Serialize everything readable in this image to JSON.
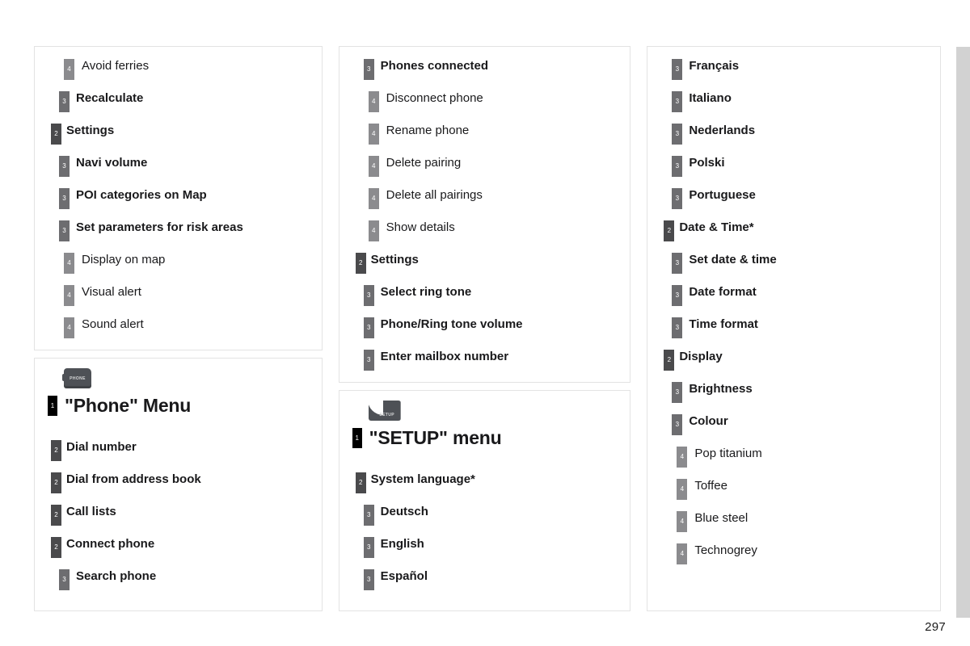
{
  "page": {
    "number": "297",
    "colors": {
      "level1_badge": "#000000",
      "level2_badge": "#4a4a4c",
      "level3_badge": "#6d6d70",
      "level4_badge": "#8b8b8e",
      "icon": "#4e5156",
      "edge_tab": "#d2d2d2",
      "panel_border": "#e3e3e3"
    }
  },
  "columns": [
    {
      "name": "left",
      "panels": [
        {
          "name": "nav-settings-panel",
          "rows": [
            {
              "level": 4,
              "badge": "4",
              "label": "Avoid ferries"
            },
            {
              "level": 3,
              "badge": "3",
              "label": "Recalculate"
            },
            {
              "level": 2,
              "badge": "2",
              "label": "Settings"
            },
            {
              "level": 3,
              "badge": "3",
              "label": "Navi volume"
            },
            {
              "level": 3,
              "badge": "3",
              "label": "POI categories on Map"
            },
            {
              "level": 3,
              "badge": "3",
              "label": "Set parameters for risk areas"
            },
            {
              "level": 4,
              "badge": "4",
              "label": "Display on map"
            },
            {
              "level": 4,
              "badge": "4",
              "label": "Visual alert"
            },
            {
              "level": 4,
              "badge": "4",
              "label": "Sound alert"
            }
          ]
        },
        {
          "name": "phone-menu-panel",
          "icon": {
            "name": "phone-button-icon",
            "glyph": "PHONE"
          },
          "rows": [
            {
              "level": 1,
              "badge": "1",
              "label": "\"Phone\" Menu",
              "title": true
            },
            {
              "level": 2,
              "badge": "2",
              "label": "Dial number"
            },
            {
              "level": 2,
              "badge": "2",
              "label": "Dial from address book"
            },
            {
              "level": 2,
              "badge": "2",
              "label": "Call lists"
            },
            {
              "level": 2,
              "badge": "2",
              "label": "Connect phone"
            },
            {
              "level": 3,
              "badge": "3",
              "label": "Search phone"
            }
          ]
        }
      ]
    },
    {
      "name": "middle",
      "panels": [
        {
          "name": "phones-connected-panel",
          "rows": [
            {
              "level": 3,
              "badge": "3",
              "label": "Phones connected"
            },
            {
              "level": 4,
              "badge": "4",
              "label": "Disconnect phone"
            },
            {
              "level": 4,
              "badge": "4",
              "label": "Rename phone"
            },
            {
              "level": 4,
              "badge": "4",
              "label": "Delete pairing"
            },
            {
              "level": 4,
              "badge": "4",
              "label": "Delete all pairings"
            },
            {
              "level": 4,
              "badge": "4",
              "label": "Show details"
            },
            {
              "level": 2,
              "badge": "2",
              "label": "Settings"
            },
            {
              "level": 3,
              "badge": "3",
              "label": "Select ring tone"
            },
            {
              "level": 3,
              "badge": "3",
              "label": "Phone/Ring tone volume"
            },
            {
              "level": 3,
              "badge": "3",
              "label": "Enter mailbox number"
            }
          ]
        },
        {
          "name": "setup-menu-panel",
          "icon": {
            "name": "setup-button-icon",
            "glyph": "SETUP"
          },
          "rows": [
            {
              "level": 1,
              "badge": "1",
              "label": "\"SETUP\" menu",
              "title": true
            },
            {
              "level": 2,
              "badge": "2",
              "label": "System language*"
            },
            {
              "level": 3,
              "badge": "3",
              "label": "Deutsch"
            },
            {
              "level": 3,
              "badge": "3",
              "label": "English"
            },
            {
              "level": 3,
              "badge": "3",
              "label": "Español"
            }
          ]
        }
      ]
    },
    {
      "name": "right",
      "panels": [
        {
          "name": "languages-datetime-display-panel",
          "rows": [
            {
              "level": 3,
              "badge": "3",
              "label": "Français"
            },
            {
              "level": 3,
              "badge": "3",
              "label": "Italiano"
            },
            {
              "level": 3,
              "badge": "3",
              "label": "Nederlands"
            },
            {
              "level": 3,
              "badge": "3",
              "label": "Polski"
            },
            {
              "level": 3,
              "badge": "3",
              "label": "Portuguese"
            },
            {
              "level": 2,
              "badge": "2",
              "label": "Date & Time*"
            },
            {
              "level": 3,
              "badge": "3",
              "label": "Set date & time"
            },
            {
              "level": 3,
              "badge": "3",
              "label": "Date format"
            },
            {
              "level": 3,
              "badge": "3",
              "label": "Time format"
            },
            {
              "level": 2,
              "badge": "2",
              "label": "Display"
            },
            {
              "level": 3,
              "badge": "3",
              "label": "Brightness"
            },
            {
              "level": 3,
              "badge": "3",
              "label": "Colour"
            },
            {
              "level": 4,
              "badge": "4",
              "label": "Pop titanium"
            },
            {
              "level": 4,
              "badge": "4",
              "label": "Toffee"
            },
            {
              "level": 4,
              "badge": "4",
              "label": "Blue steel"
            },
            {
              "level": 4,
              "badge": "4",
              "label": "Technogrey"
            }
          ]
        }
      ]
    }
  ]
}
